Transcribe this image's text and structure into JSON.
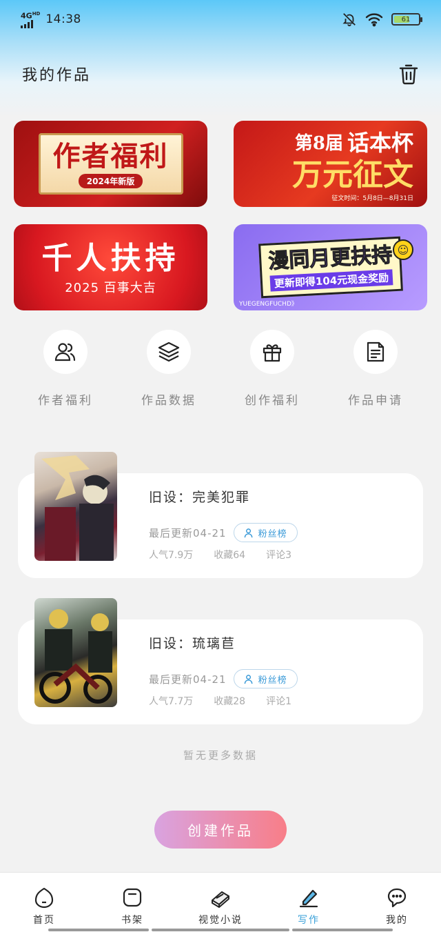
{
  "status_bar": {
    "network": "4G",
    "network_sup": "HD",
    "time": "14:38",
    "battery": "61"
  },
  "header": {
    "title": "我的作品"
  },
  "banners": [
    {
      "main": "作者福利",
      "sub": "2024年新版"
    },
    {
      "pre": "第8届",
      "cup": "话本杯",
      "main": "万元征文",
      "date": "征文时间：5月8日—8月31日"
    },
    {
      "main": "千人扶持",
      "sub": "2025 百事大吉"
    },
    {
      "main": "漫同月更扶持",
      "sub": "更新即得104元现金奖励",
      "foot": "YUEGENGFUCHD》"
    }
  ],
  "shortcuts": [
    {
      "label": "作者福利",
      "icon": "users-icon"
    },
    {
      "label": "作品数据",
      "icon": "layers-icon"
    },
    {
      "label": "创作福利",
      "icon": "gift-icon"
    },
    {
      "label": "作品申请",
      "icon": "document-icon"
    }
  ],
  "works": [
    {
      "title": "旧设：完美犯罪",
      "updated": "最后更新04-21",
      "fans_label": "粉丝榜",
      "popularity": "人气7.9万",
      "favorites": "收藏64",
      "comments": "评论3"
    },
    {
      "title": "旧设：琉璃苣",
      "updated": "最后更新04-21",
      "fans_label": "粉丝榜",
      "popularity": "人气7.7万",
      "favorites": "收藏28",
      "comments": "评论1"
    }
  ],
  "no_more": "暂无更多数据",
  "create_button": "创建作品",
  "tabbar": [
    {
      "label": "首页",
      "icon": "home-icon"
    },
    {
      "label": "书架",
      "icon": "bookshelf-icon"
    },
    {
      "label": "视觉小说",
      "icon": "book-icon"
    },
    {
      "label": "写作",
      "icon": "pen-icon",
      "active": true
    },
    {
      "label": "我的",
      "icon": "chat-bubble-icon"
    }
  ],
  "colors": {
    "accent": "#3aa0d8",
    "create_gradient_start": "#d9a3e0",
    "create_gradient_end": "#f87e88"
  }
}
